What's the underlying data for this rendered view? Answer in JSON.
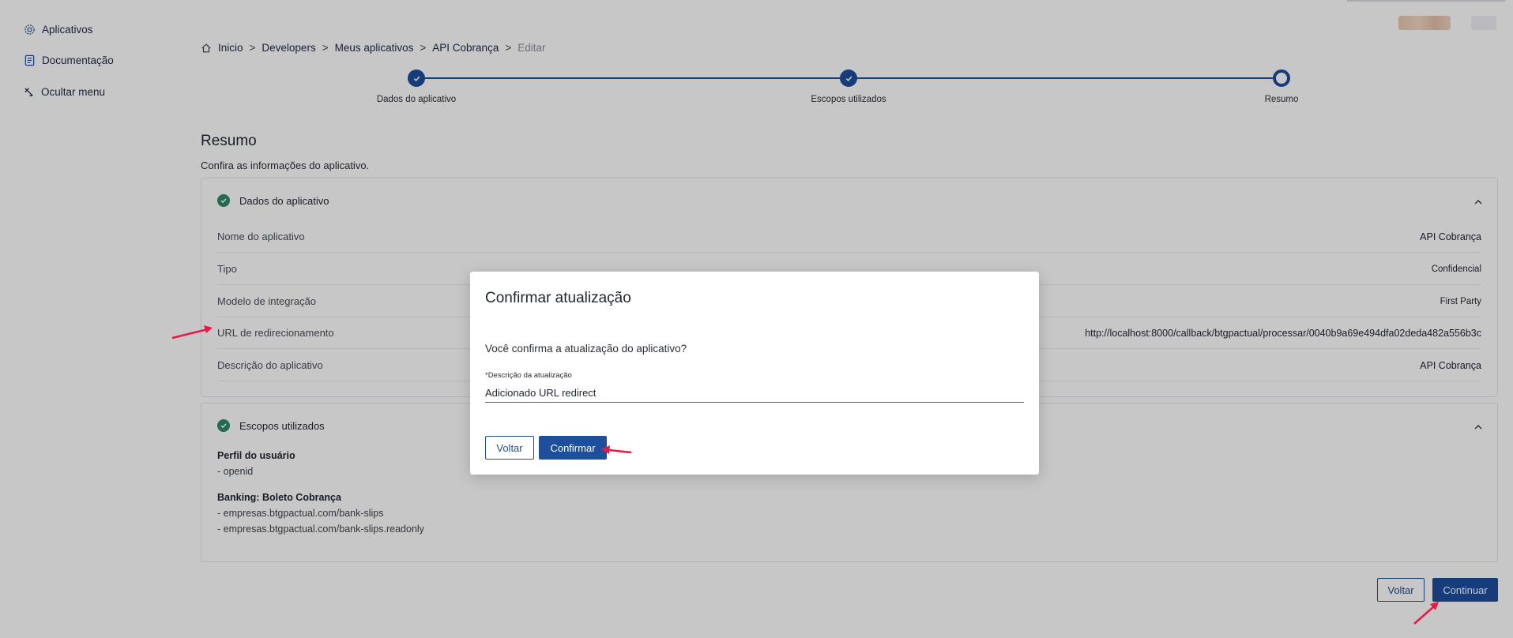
{
  "sidebar": {
    "items": [
      {
        "label": "Aplicativos",
        "icon": "gear-icon"
      },
      {
        "label": "Documentação",
        "icon": "document-icon"
      },
      {
        "label": "Ocultar menu",
        "icon": "hide-menu-icon"
      }
    ]
  },
  "breadcrumb": {
    "items": [
      "Inicio",
      "Developers",
      "Meus aplicativos",
      "API Cobrança"
    ],
    "current": "Editar",
    "separator": ">"
  },
  "stepper": {
    "steps": [
      {
        "label": "Dados do aplicativo",
        "state": "done"
      },
      {
        "label": "Escopos utilizados",
        "state": "done"
      },
      {
        "label": "Resumo",
        "state": "current"
      }
    ]
  },
  "page": {
    "title": "Resumo",
    "subtitle": "Confira as informações do aplicativo."
  },
  "app_card": {
    "title": "Dados do aplicativo",
    "rows": [
      {
        "key": "Nome do aplicativo",
        "value": "API Cobrança"
      },
      {
        "key": "Tipo",
        "value": "Confidencial"
      },
      {
        "key": "Modelo de integração",
        "value": "First Party"
      },
      {
        "key": "URL de redirecionamento",
        "value": "http://localhost:8000/callback/btgpactual/processar/0040b9a69e494dfa02deda482a556b3c"
      },
      {
        "key": "Descrição do aplicativo",
        "value": "API Cobrança"
      }
    ]
  },
  "scopes_card": {
    "title": "Escopos utilizados",
    "groups": [
      {
        "title": "Perfil do usuário",
        "items": [
          "- openid"
        ]
      },
      {
        "title": "Banking: Boleto Cobrança",
        "items": [
          "- empresas.btgpactual.com/bank-slips",
          "- empresas.btgpactual.com/bank-slips.readonly"
        ]
      }
    ]
  },
  "footer": {
    "back_label": "Voltar",
    "continue_label": "Continuar"
  },
  "modal": {
    "title": "Confirmar atualização",
    "question": "Você confirma a atualização do aplicativo?",
    "field_label": "*Descrição da atualização",
    "field_value": "Adicionado URL redirect",
    "back_label": "Voltar",
    "confirm_label": "Confirmar"
  },
  "colors": {
    "primary": "#1d4f9c",
    "success": "#2e8b66",
    "focus_underline": "#8e44ad",
    "annotation_arrow": "#e8194a"
  }
}
